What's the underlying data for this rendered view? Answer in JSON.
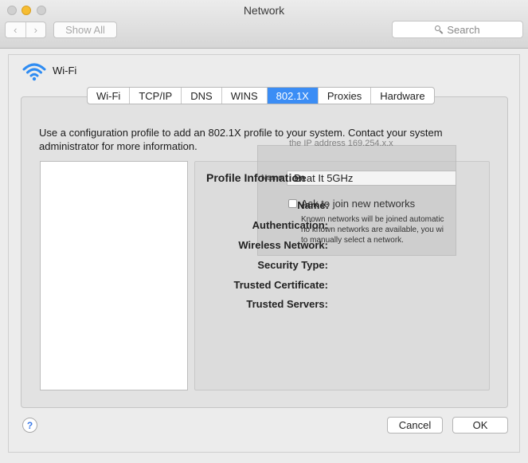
{
  "window": {
    "title": "Network"
  },
  "toolbar": {
    "back_glyph": "‹",
    "forward_glyph": "›",
    "show_all": "Show All",
    "search_placeholder": "Search"
  },
  "header": {
    "interface_name": "Wi-Fi"
  },
  "tabs": [
    {
      "label": "Wi-Fi",
      "active": false
    },
    {
      "label": "TCP/IP",
      "active": false
    },
    {
      "label": "DNS",
      "active": false
    },
    {
      "label": "WINS",
      "active": false
    },
    {
      "label": "802.1X",
      "active": true
    },
    {
      "label": "Proxies",
      "active": false
    },
    {
      "label": "Hardware",
      "active": false
    }
  ],
  "description": "Use a configuration profile to add an 802.1X profile to your system. Contact your system administrator for more information.",
  "profile_info": {
    "heading": "Profile Information",
    "name_label": "Name:",
    "authentication_label": "Authentication:",
    "wireless_network_label": "Wireless Network:",
    "security_type_label": "Security Type:",
    "trusted_certificate_label": "Trusted Certificate:",
    "trusted_servers_label": "Trusted Servers:"
  },
  "overlay": {
    "top_line": "the IP address 169.254.x.x",
    "network_name_label": "Name:",
    "network_name_value": "Beat It 5GHz",
    "ask_to_join": "Ask to join new networks",
    "note_line1": "Known networks will be joined automatic",
    "note_line2": "no known networks are available, you wi",
    "note_line3": "to manually select a network."
  },
  "footer": {
    "help": "?",
    "cancel": "Cancel",
    "ok": "OK"
  },
  "colors": {
    "accent": "#3b8df5",
    "wifi_icon": "#2f8cf2"
  }
}
